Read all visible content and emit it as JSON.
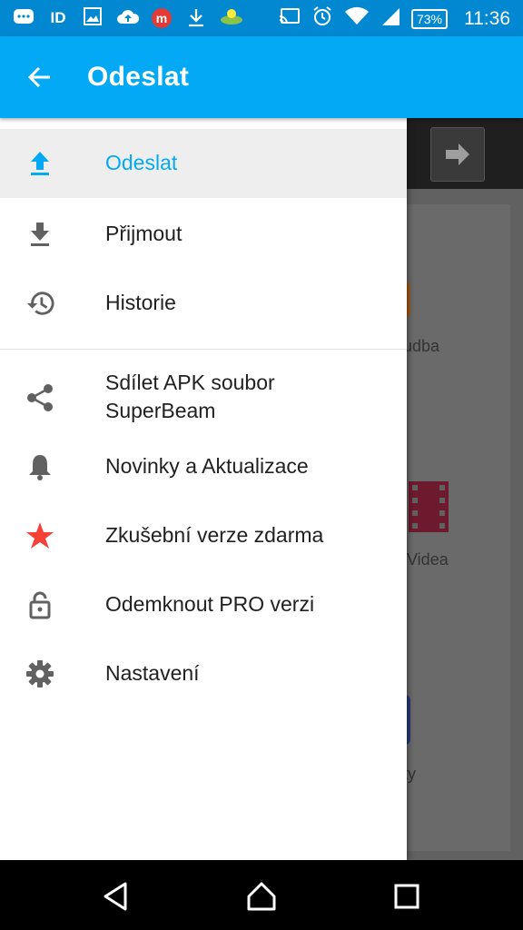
{
  "status_bar": {
    "battery": "73%",
    "time": "11:36",
    "left_icons": [
      "messaging-icon",
      "id-icon",
      "image-icon",
      "cloud-upload-icon",
      "m-app-icon",
      "download-icon",
      "landscape-app-icon"
    ],
    "right_icons": [
      "cast-icon",
      "alarm-icon",
      "wifi-icon",
      "signal-icon",
      "battery-icon"
    ]
  },
  "app_bar": {
    "title": "Odeslat",
    "color": "#03a9f4"
  },
  "drawer": {
    "items": [
      {
        "label": "Odeslat",
        "icon": "upload-icon",
        "active": true
      },
      {
        "label": "Přijmout",
        "icon": "download-icon",
        "active": false
      },
      {
        "label": "Historie",
        "icon": "history-icon",
        "active": false
      },
      {
        "label": "Sdílet APK soubor SuperBeam",
        "icon": "share-icon",
        "active": false
      },
      {
        "label": "Novinky a Aktualizace",
        "icon": "bell-icon",
        "active": false
      },
      {
        "label": "Zkušební verze zdarma",
        "icon": "star-icon",
        "active": false
      },
      {
        "label": "Odemknout PRO verzi",
        "icon": "unlock-icon",
        "active": false
      },
      {
        "label": "Nastavení",
        "icon": "gear-icon",
        "active": false
      }
    ]
  },
  "background": {
    "labels": [
      "udba",
      "Videa",
      "ty"
    ]
  },
  "colors": {
    "accent": "#03a9f4",
    "status_bar": "#0288d1",
    "star": "#f44336"
  }
}
